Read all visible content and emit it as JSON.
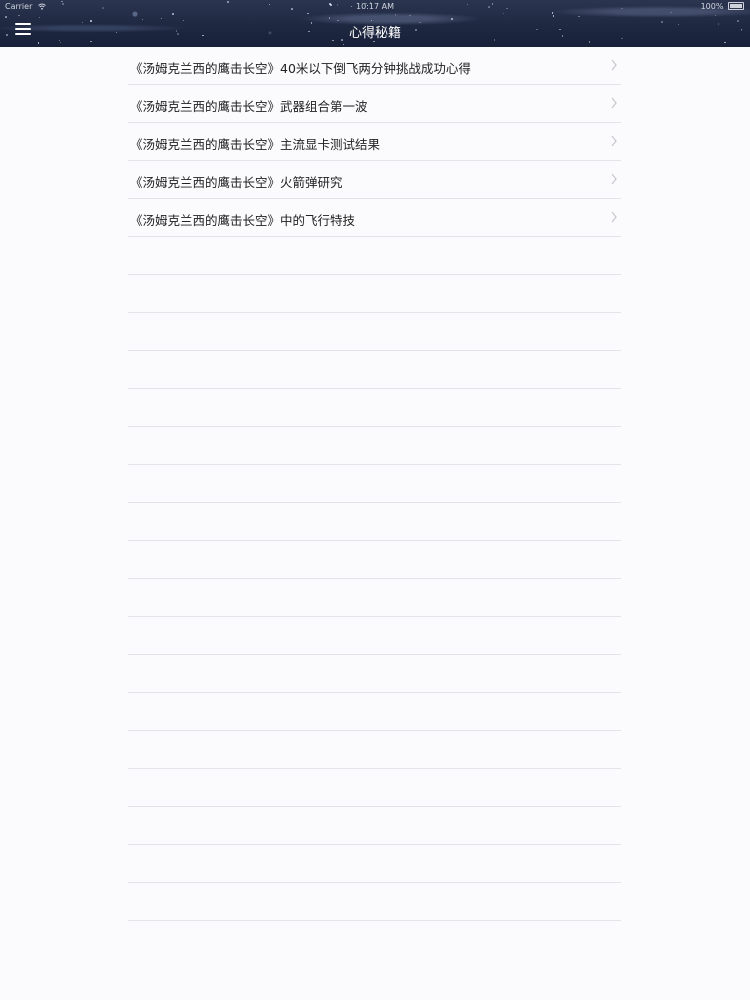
{
  "status_bar": {
    "carrier": "Carrier",
    "time": "10:17 AM",
    "battery": "100%"
  },
  "nav": {
    "title": "心得秘籍",
    "menu_icon": "hamburger-menu-icon"
  },
  "list": {
    "items": [
      {
        "label": "《汤姆克兰西的鹰击长空》40米以下倒飞两分钟挑战成功心得"
      },
      {
        "label": "《汤姆克兰西的鹰击长空》武器组合第一波"
      },
      {
        "label": "《汤姆克兰西的鹰击长空》主流显卡测试结果"
      },
      {
        "label": "《汤姆克兰西的鹰击长空》火箭弹研究"
      },
      {
        "label": "《汤姆克兰西的鹰击长空》中的飞行特技"
      }
    ],
    "empty_row_count": 18
  },
  "colors": {
    "nav_background": "#1e2740",
    "separator": "#e3e3e8",
    "chevron": "#c7c7cc",
    "page_background": "#fbfbfd"
  }
}
